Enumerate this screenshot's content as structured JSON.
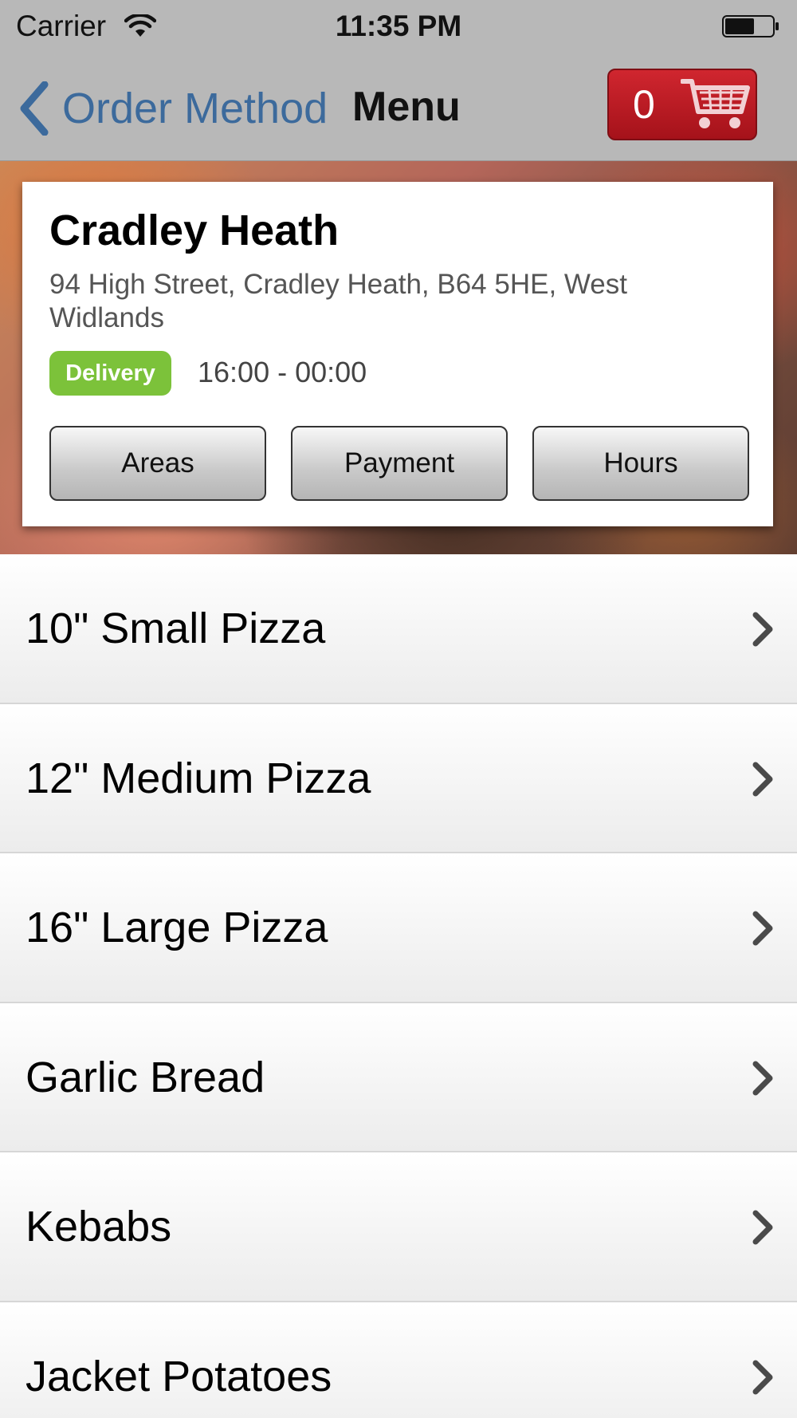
{
  "status_bar": {
    "carrier": "Carrier",
    "time": "11:35 PM",
    "wifi_icon": "wifi-icon",
    "battery_icon": "battery-icon"
  },
  "nav": {
    "back_label": "Order Method",
    "title": "Menu",
    "cart_count": "0",
    "cart_icon": "shopping-cart-icon",
    "accent_color": "#3c6a9c",
    "cart_color": "#c01a24"
  },
  "store": {
    "name": "Cradley Heath",
    "address": "94 High Street, Cradley Heath, B64 5HE, West Widlands",
    "badge": "Delivery",
    "badge_color": "#7cc23a",
    "hours": "16:00 - 00:00",
    "buttons": {
      "areas": "Areas",
      "payment": "Payment",
      "hours": "Hours"
    }
  },
  "menu": {
    "items": [
      {
        "label": "10\" Small Pizza"
      },
      {
        "label": "12\" Medium Pizza"
      },
      {
        "label": "16\" Large Pizza"
      },
      {
        "label": "Garlic Bread"
      },
      {
        "label": "Kebabs"
      },
      {
        "label": "Jacket Potatoes"
      }
    ]
  }
}
